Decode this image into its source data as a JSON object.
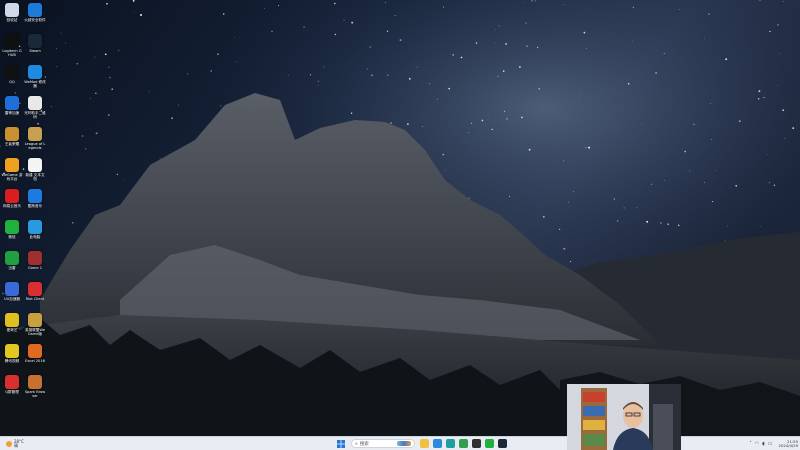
{
  "desktop": {
    "wallpaper": "starry-night-mountain",
    "icons": [
      {
        "label": "回收站",
        "icon": "recycle-bin-icon",
        "color": "#cfd8e6"
      },
      {
        "label": "火绒安全软件",
        "icon": "huorong-icon",
        "color": "#1e7ad8"
      },
      {
        "label": "Logitech G HUB",
        "icon": "logitech-ghub-icon",
        "color": "#101010"
      },
      {
        "label": "Steam",
        "icon": "steam-icon",
        "color": "#1b2838"
      },
      {
        "label": "QQ",
        "icon": "qq-icon",
        "color": "#111111"
      },
      {
        "label": "WeMod 修改器",
        "icon": "wemod-icon",
        "color": "#1f8ae0"
      },
      {
        "label": "雷神加速",
        "icon": "leishen-icon",
        "color": "#1e6fd8"
      },
      {
        "label": "光环助手二维码",
        "icon": "qr-code-icon",
        "color": "#e8e8e8"
      },
      {
        "label": "王者荣耀",
        "icon": "honor-of-kings-icon",
        "color": "#c89030"
      },
      {
        "label": "League of Legends",
        "icon": "league-of-legends-icon",
        "color": "#c8a050"
      },
      {
        "label": "WeGame 游戏平台",
        "icon": "wegame-icon",
        "color": "#f0a020"
      },
      {
        "label": "新建 文本文档",
        "icon": "text-file-icon",
        "color": "#f4f4f4"
      },
      {
        "label": "网易云音乐",
        "icon": "netease-music-icon",
        "color": "#d81e1e"
      },
      {
        "label": "酷狗音乐",
        "icon": "kugou-icon",
        "color": "#1e7ae0"
      },
      {
        "label": "微信",
        "icon": "wechat-icon",
        "color": "#20b040"
      },
      {
        "label": "此电脑",
        "icon": "this-pc-icon",
        "color": "#2a9ae0"
      },
      {
        "label": "迅雷",
        "icon": "xunlei-icon",
        "color": "#20a040"
      },
      {
        "label": "Game 1",
        "icon": "game-icon",
        "color": "#a03030"
      },
      {
        "label": "UU加速器",
        "icon": "uu-accelerator-icon",
        "color": "#3a6ad8"
      },
      {
        "label": "Riot Client",
        "icon": "riot-client-icon",
        "color": "#d83030"
      },
      {
        "label": "爱奇艺",
        "icon": "iqiyi-icon",
        "color": "#e0c020"
      },
      {
        "label": "英雄联盟WeGame版",
        "icon": "lol-wegame-icon",
        "color": "#c8a040"
      },
      {
        "label": "腾讯视频",
        "icon": "tencent-video-icon",
        "color": "#e0c820"
      },
      {
        "label": "Excel 2016",
        "icon": "office-icon",
        "color": "#e06a20"
      },
      {
        "label": "Q群管理",
        "icon": "qq-group-icon",
        "color": "#d83030"
      },
      {
        "label": "Spark Browser",
        "icon": "browser-shortcut-icon",
        "color": "#c87030"
      }
    ]
  },
  "taskbar": {
    "weather": {
      "temp": "28°C",
      "condition": "晴"
    },
    "search_placeholder": "搜索",
    "apps": [
      {
        "name": "file-explorer",
        "color": "#f0c040"
      },
      {
        "name": "browser",
        "color": "#2a8ae0"
      },
      {
        "name": "edge",
        "color": "#1ea0a0"
      },
      {
        "name": "chrome",
        "color": "#30a050"
      },
      {
        "name": "obs",
        "color": "#303030"
      },
      {
        "name": "wechat",
        "color": "#20b040"
      },
      {
        "name": "steam",
        "color": "#1b2838"
      }
    ],
    "clock_time": "21:55",
    "clock_date": "2024/4/29"
  },
  "webcam": {
    "shown": true
  }
}
